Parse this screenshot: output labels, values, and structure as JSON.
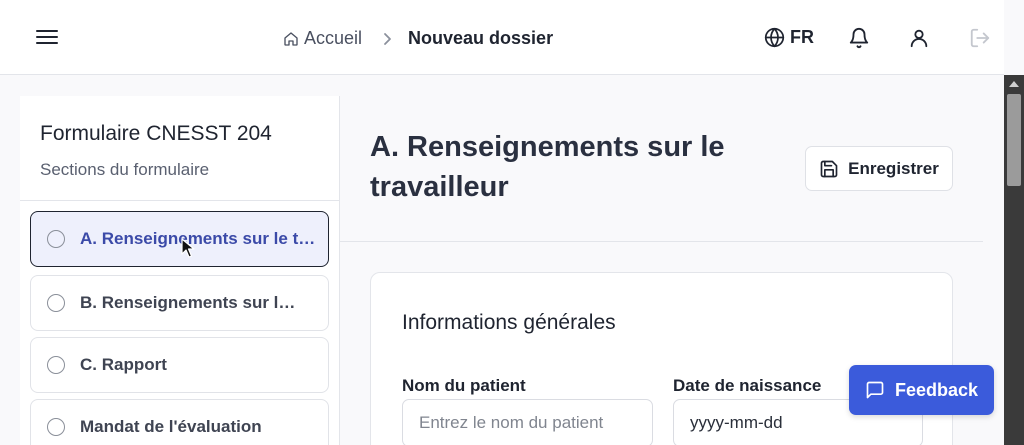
{
  "header": {
    "breadcrumb_home": "Accueil",
    "breadcrumb_current": "Nouveau dossier",
    "language": "FR",
    "icons": [
      "menu-icon",
      "home-icon",
      "chevron-right-icon",
      "globe-icon",
      "bell-icon",
      "user-icon",
      "logout-icon"
    ]
  },
  "sidebar": {
    "title": "Formulaire CNESST 204",
    "subtitle": "Sections du formulaire",
    "items": [
      {
        "label": "A. Renseignements sur le travailleur",
        "active": true
      },
      {
        "label": "B. Renseignements sur le médecin",
        "active": false
      },
      {
        "label": "C. Rapport",
        "active": false
      },
      {
        "label": "Mandat de l'évaluation",
        "active": false
      }
    ]
  },
  "main": {
    "title": "A. Renseignements sur le travailleur",
    "save_label": "Enregistrer",
    "card": {
      "title": "Informations générales",
      "patient_name_label": "Nom du patient",
      "patient_name_placeholder": "Entrez le nom du patient",
      "birth_date_label": "Date de naissance",
      "birth_date_value": "yyyy-mm-dd"
    }
  },
  "feedback_label": "Feedback",
  "colors": {
    "accent": "#3b5bdb",
    "active_item_bg": "#eef0fc",
    "active_item_text": "#3b4aa8"
  }
}
